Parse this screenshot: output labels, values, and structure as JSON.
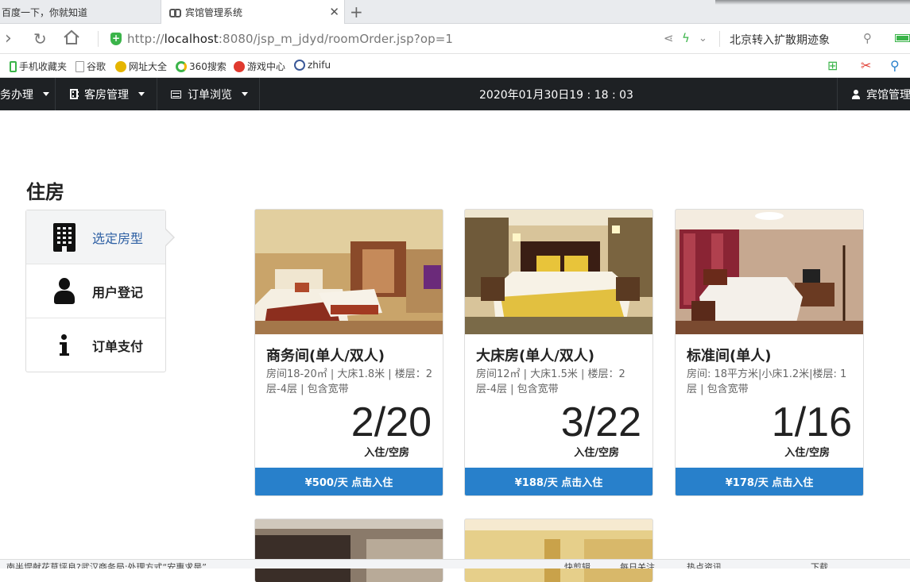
{
  "browser": {
    "tabs": [
      {
        "title": "百度一下，你就知道"
      },
      {
        "title": "宾馆管理系统"
      }
    ],
    "url": {
      "prefix": "http://",
      "host": "localhost",
      "rest": ":8080/jsp_m_jdyd/roomOrder.jsp?op=1"
    },
    "hot_search": "北京转入扩散期迹象",
    "bookmarks": [
      {
        "label": "手机收藏夹",
        "icon": "phone-icon",
        "color": "#3bb44a"
      },
      {
        "label": "谷歌",
        "icon": "page-icon",
        "color": "#999999"
      },
      {
        "label": "网址大全",
        "icon": "web-directory-icon",
        "color": "#d8a800"
      },
      {
        "label": "360搜索",
        "icon": "360-search-icon",
        "color": "#3bb44a"
      },
      {
        "label": "游戏中心",
        "icon": "game-center-icon",
        "color": "#e03a2f"
      },
      {
        "label": "zhifu",
        "icon": "globe-icon",
        "color": "#3b5998"
      }
    ],
    "status_items": [
      "南半堤献花草坪良?武汉商务局:处理方式“安惠求是”",
      "快剪辑",
      "每日关注",
      "热点资讯",
      "下载"
    ]
  },
  "navbar": {
    "items": [
      {
        "label": "务办理"
      },
      {
        "label": "客房管理"
      },
      {
        "label": "订单浏览"
      }
    ],
    "datetime": "2020年01月30日19 : 18 : 03",
    "user": "宾馆管理"
  },
  "page": {
    "title": "住房",
    "steps": [
      {
        "label": "选定房型",
        "icon": "building-icon",
        "active": true
      },
      {
        "label": "用户登记",
        "icon": "user-icon",
        "active": false
      },
      {
        "label": "订单支付",
        "icon": "info-icon",
        "active": false
      }
    ],
    "rooms": [
      {
        "name": "商务间(单人/双人)",
        "desc": "房间18-20㎡ | 大床1.8米 | 楼层：2层-4层 | 包含宽带",
        "count": "2/20",
        "count_label": "入住/空房",
        "button": "¥500/天 点击入住"
      },
      {
        "name": "大床房(单人/双人)",
        "desc": "房间12㎡ | 大床1.5米 | 楼层：2层-4层 | 包含宽带",
        "count": "3/22",
        "count_label": "入住/空房",
        "button": "¥188/天 点击入住"
      },
      {
        "name": "标准间(单人)",
        "desc": "房间: 18平方米|小床1.2米|楼层: 1层 | 包含宽带",
        "count": "1/16",
        "count_label": "入住/空房",
        "button": "¥178/天 点击入住"
      }
    ]
  },
  "colors": {
    "accent": "#2880cb",
    "navbar": "#1e2124",
    "active_step_text": "#2d5fa3"
  }
}
